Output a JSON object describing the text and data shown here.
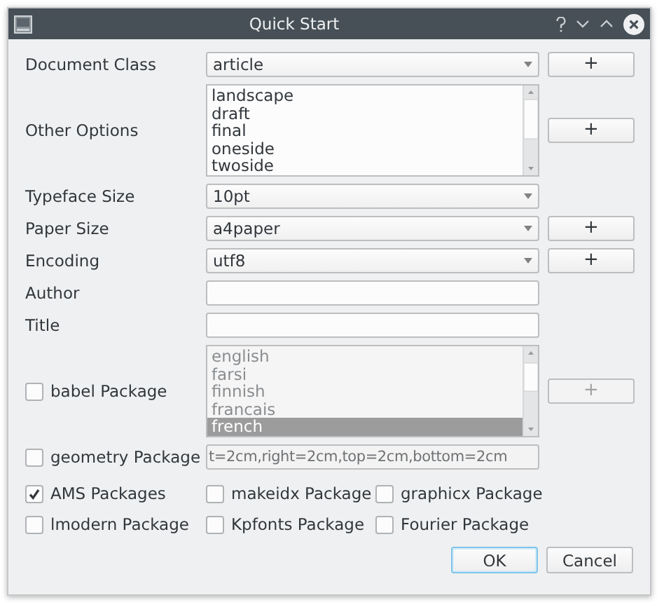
{
  "window": {
    "title": "Quick Start"
  },
  "rows": [
    {
      "kind": "combo",
      "label": "Document Class",
      "value": "article",
      "add_button": "+"
    },
    {
      "kind": "list",
      "label": "Other Options",
      "disabled": false,
      "add_button": "+",
      "items": [
        {
          "text": "landscape",
          "selected": false
        },
        {
          "text": "draft",
          "selected": false
        },
        {
          "text": "final",
          "selected": false
        },
        {
          "text": "oneside",
          "selected": false
        },
        {
          "text": "twoside",
          "selected": false
        }
      ]
    },
    {
      "kind": "combo",
      "label": "Typeface Size",
      "value": "10pt"
    },
    {
      "kind": "combo",
      "label": "Paper Size",
      "value": "a4paper",
      "add_button": "+"
    },
    {
      "kind": "combo",
      "label": "Encoding",
      "value": "utf8",
      "add_button": "+"
    },
    {
      "kind": "text",
      "label": "Author"
    },
    {
      "kind": "text",
      "label": "Title"
    },
    {
      "kind": "list",
      "label": "babel Package",
      "checked": false,
      "disabled": true,
      "add_button": "+",
      "items": [
        {
          "text": "english",
          "selected": false
        },
        {
          "text": "farsi",
          "selected": false
        },
        {
          "text": "finnish",
          "selected": false
        },
        {
          "text": "francais",
          "selected": false
        },
        {
          "text": "french",
          "selected": true
        }
      ]
    },
    {
      "kind": "text",
      "label": "geometry Package",
      "checked": false,
      "disabled": true,
      "value": "t=2cm,right=2cm,top=2cm,bottom=2cm"
    }
  ],
  "packages": [
    {
      "label": "AMS Packages",
      "checked": true
    },
    {
      "label": "makeidx Package",
      "checked": false
    },
    {
      "label": "graphicx Package",
      "checked": false
    },
    {
      "label": "lmodern Package",
      "checked": false
    },
    {
      "label": "Kpfonts Package",
      "checked": false
    },
    {
      "label": "Fourier Package",
      "checked": false
    }
  ],
  "buttons": [
    {
      "label": "OK",
      "default": true
    },
    {
      "label": "Cancel",
      "default": false
    }
  ]
}
